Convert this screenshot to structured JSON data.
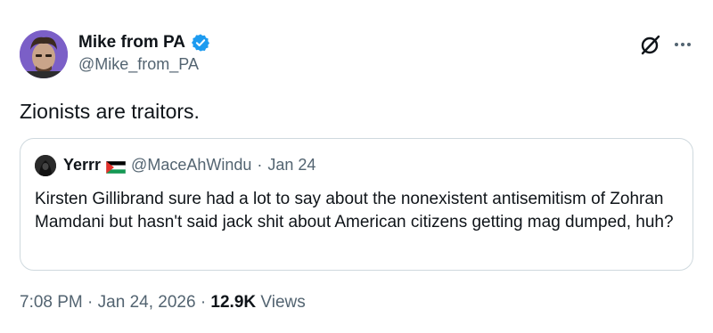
{
  "author": {
    "display_name": "Mike from PA",
    "handle": "@Mike_from_PA"
  },
  "icons": {
    "verified": "verified-badge-icon",
    "grok": "grok-icon",
    "more": "more-options-icon",
    "flag": "palestine-flag-icon"
  },
  "colors": {
    "verified_blue": "#1d9bf0",
    "secondary_text": "#536471",
    "primary_text": "#0f1419",
    "border": "#cfd9de"
  },
  "tweet": {
    "text": "Zionists are traitors."
  },
  "quote": {
    "display_name": "Yerrr",
    "handle": "@MaceAhWindu",
    "separator": "·",
    "date": "Jan 24",
    "text": "Kirsten Gillibrand sure had a lot to say about the nonexistent antisemitism of Zohran Mamdani but hasn't said jack shit about American citizens getting mag dumped, huh?"
  },
  "meta": {
    "time": "7:08 PM",
    "sep1": "·",
    "date": "Jan 24, 2026",
    "sep2": "·",
    "views_count": "12.9K",
    "views_label": "Views"
  }
}
